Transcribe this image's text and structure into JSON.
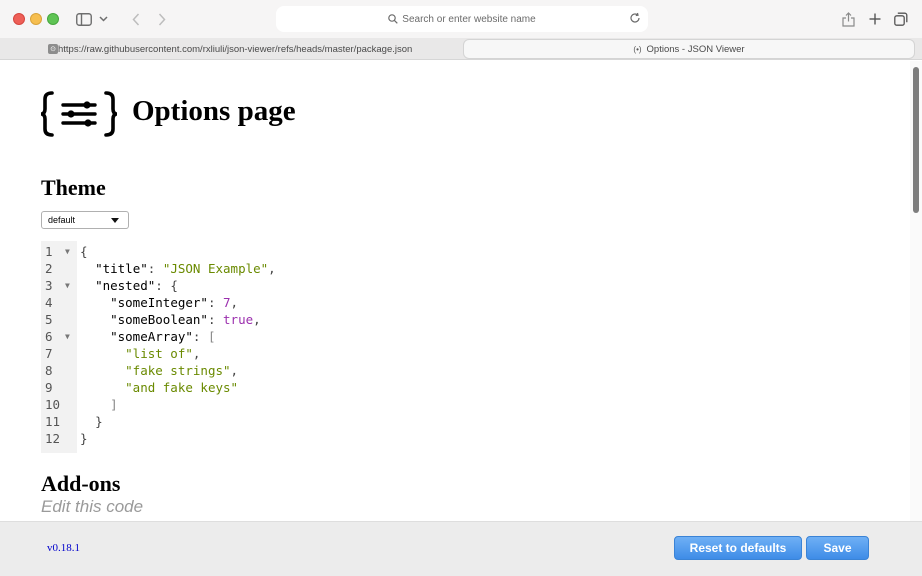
{
  "browser": {
    "address_placeholder": "Search or enter website name",
    "tabs": [
      {
        "label": "https://raw.githubusercontent.com/rxliuli/json-viewer/refs/heads/master/package.json"
      },
      {
        "label": "Options - JSON Viewer"
      }
    ]
  },
  "page": {
    "title": "Options page",
    "theme_heading": "Theme",
    "theme_select_value": "default",
    "addons_heading": "Add-ons",
    "addons_hint": "Edit this code"
  },
  "editor": {
    "lines": [
      {
        "n": "1",
        "fold": true
      },
      {
        "n": "2",
        "fold": false
      },
      {
        "n": "3",
        "fold": true
      },
      {
        "n": "4",
        "fold": false
      },
      {
        "n": "5",
        "fold": false
      },
      {
        "n": "6",
        "fold": true
      },
      {
        "n": "7",
        "fold": false
      },
      {
        "n": "8",
        "fold": false
      },
      {
        "n": "9",
        "fold": false
      },
      {
        "n": "10",
        "fold": false
      },
      {
        "n": "11",
        "fold": false
      },
      {
        "n": "12",
        "fold": false
      }
    ],
    "tokens": {
      "open_brace": "{",
      "close_brace": "}",
      "title_key": "\"title\"",
      "title_val": "\"JSON Example\"",
      "nested_key": "\"nested\"",
      "some_integer_key": "\"someInteger\"",
      "some_integer_val": "7",
      "some_boolean_key": "\"someBoolean\"",
      "some_boolean_val": "true",
      "some_array_key": "\"someArray\"",
      "open_bracket": "[",
      "close_bracket": "]",
      "item1": "\"list of\"",
      "item2": "\"fake strings\"",
      "item3": "\"and fake keys\""
    }
  },
  "footer": {
    "version": "v0.18.1",
    "reset_label": "Reset to defaults",
    "save_label": "Save"
  },
  "colors": {
    "accent_button": "#3e8ce7",
    "string": "#6a8a00",
    "number": "#9b2fae",
    "version_link": "#0000cc"
  }
}
